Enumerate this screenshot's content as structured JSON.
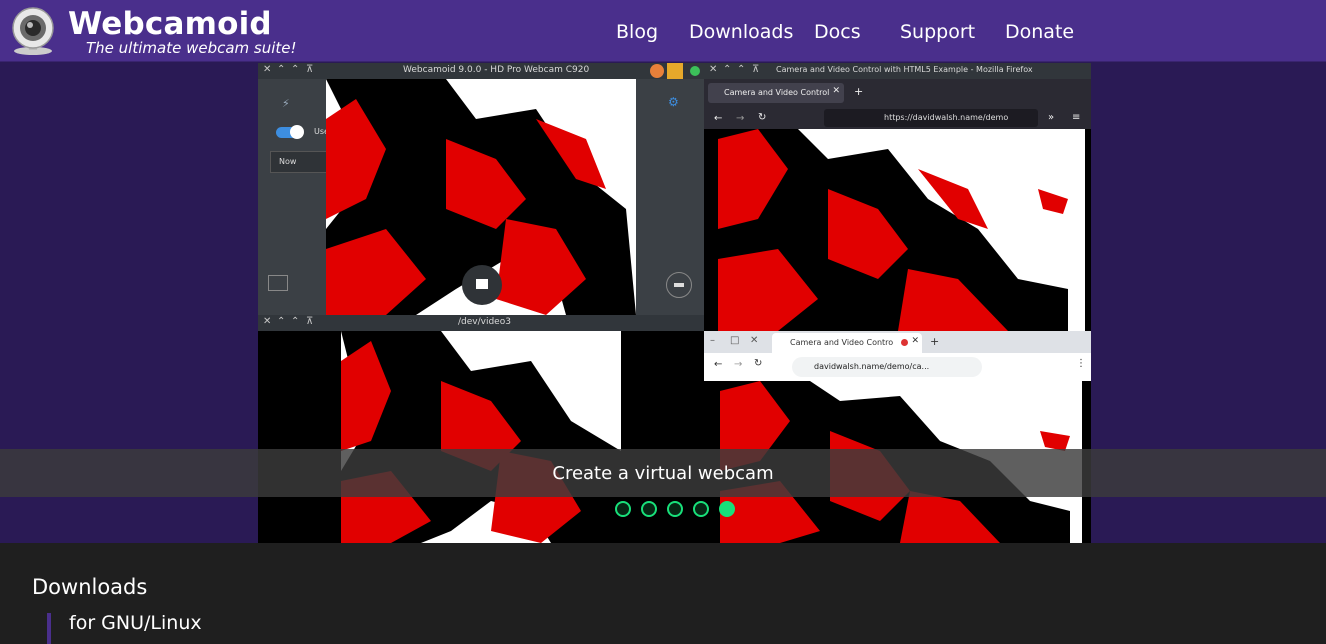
{
  "header": {
    "brand": "Webcamoid",
    "tagline": "The ultimate webcam suite!",
    "nav": [
      "Blog",
      "Downloads",
      "Docs",
      "Support",
      "Donate"
    ]
  },
  "slideshow": {
    "caption": "Create a virtual webcam",
    "dots": 5,
    "active_dot": 5,
    "screenshot": {
      "app_window_title": "Webcamoid 9.0.0 - HD Pro Webcam C920",
      "use_flash_label": "Use flash",
      "capture_mode": "Now",
      "v4l_window_title": "/dev/video3",
      "firefox_window_title": "Camera and Video Control with HTML5 Example - Mozilla Firefox",
      "firefox_tab": "Camera and Video Control",
      "firefox_url": "https://davidwalsh.name/demo",
      "chrome_tab": "Camera and Video Contro",
      "chrome_url": "davidwalsh.name/demo/ca..."
    }
  },
  "downloads": {
    "title": "Downloads",
    "platform": "for GNU/Linux"
  },
  "colors": {
    "header_bg": "#4a2f8c",
    "page_bg": "#2a1a55",
    "accent_green": "#18e07a",
    "downloads_bg": "#1f1f1f"
  }
}
